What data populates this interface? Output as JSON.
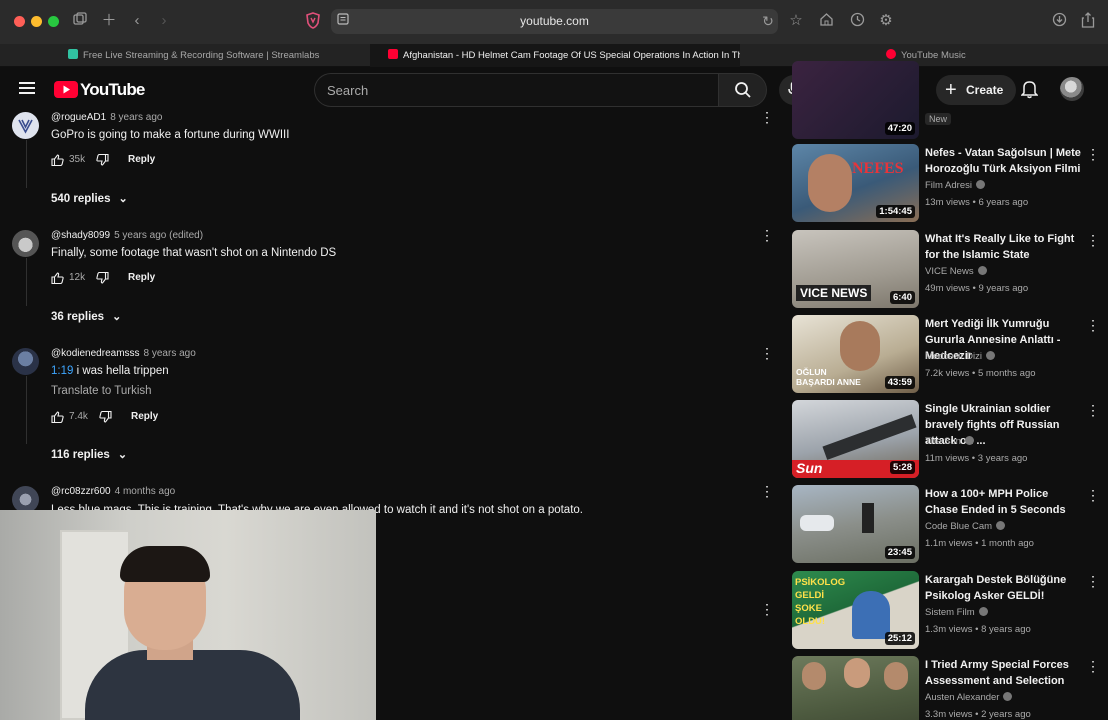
{
  "browser": {
    "url": "youtube.com",
    "tabs": [
      {
        "label": "Free Live Streaming & Recording Software | Streamlabs"
      },
      {
        "label": "Afghanistan - HD Helmet Cam Footage Of US Special Operations In Action In The Af..."
      },
      {
        "label": "YouTube Music"
      }
    ]
  },
  "header": {
    "logo_text": "YouTube",
    "search_placeholder": "Search",
    "create_label": "Create"
  },
  "comments": [
    {
      "author": "@rogueAD1",
      "age": "8 years ago",
      "text": "GoPro is going to make a fortune during WWIII",
      "likes": "35k",
      "reply_label": "Reply",
      "replies": "540 replies"
    },
    {
      "author": "@shady8099",
      "age": "5 years ago (edited)",
      "text": "Finally, some footage that wasn't shot on a Nintendo DS",
      "likes": "12k",
      "reply_label": "Reply",
      "replies": "36 replies"
    },
    {
      "author": "@kodienedreamsss",
      "age": "8 years ago",
      "timestamp": "1:19",
      "text": " i was hella trippen",
      "translate": "Translate to Turkish",
      "likes": "7.4k",
      "reply_label": "Reply",
      "replies": "116 replies"
    },
    {
      "author": "@rc08zzr600",
      "age": "4 months ago",
      "text": "Less blue mags. This is training. That's why we are even allowed to watch it and it's not shot on a potato."
    }
  ],
  "sidebar": {
    "top_partial": {
      "duration": "47:20",
      "badge": "New"
    },
    "videos": [
      {
        "title": "Nefes - Vatan Sağolsun | Mete Horozoğlu Türk Aksiyon Filmi",
        "channel": "Film Adresi",
        "meta": "13m views • 6 years ago",
        "duration": "1:54:45",
        "thumb_text": "NEFES"
      },
      {
        "title": "What It's Really Like to Fight for the Islamic State",
        "channel": "VICE News",
        "meta": "49m views • 9 years ago",
        "duration": "6:40",
        "thumb_text": "VICE NEWS"
      },
      {
        "title": "Mert Yediği İlk Yumruğu Gururla Annesine Anlattı - Medcezir",
        "channel": "Medcezir Dizi",
        "meta": "7.2k views • 5 months ago",
        "duration": "43:59",
        "thumb_text": "OĞLUN BAŞARDI ANNE"
      },
      {
        "title": "Single Ukrainian soldier bravely fights off Russian attack on ...",
        "channel": "The Sun",
        "meta": "11m views • 3 years ago",
        "duration": "5:28",
        "thumb_text": "Sun"
      },
      {
        "title": "How a 100+ MPH Police Chase Ended in 5 Seconds",
        "channel": "Code Blue Cam",
        "meta": "1.1m views • 1 month ago",
        "duration": "23:45",
        "thumb_text": ""
      },
      {
        "title": "Karargah Destek Bölüğüne Psikolog Asker GELDİ!",
        "channel": "Sistem Film",
        "meta": "1.3m views • 8 years ago",
        "duration": "25:12",
        "thumb_text": "PSİKOLOG GELDİ ŞOKE OLDU!"
      },
      {
        "title": "I Tried Army Special Forces Assessment and Selection",
        "channel": "Austen Alexander",
        "meta": "3.3m views • 2 years ago",
        "duration": "",
        "thumb_text": ""
      }
    ]
  }
}
